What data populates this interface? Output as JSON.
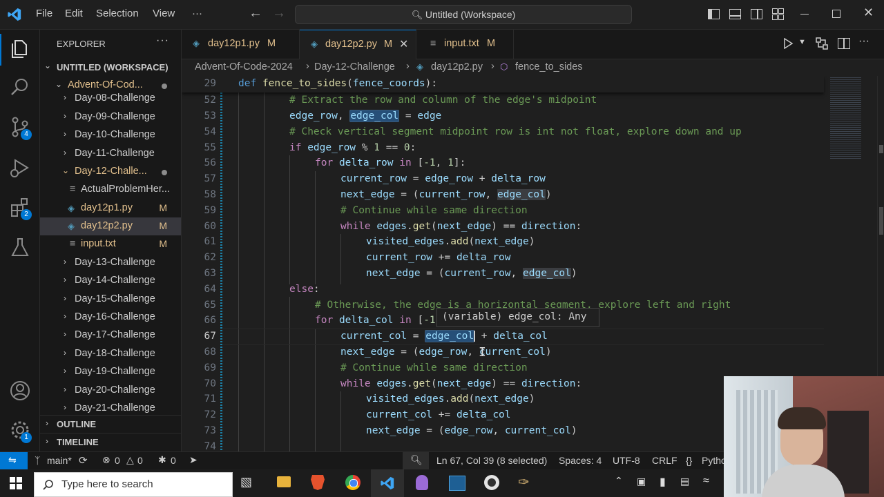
{
  "titlebar": {
    "menu": [
      "File",
      "Edit",
      "Selection",
      "View",
      "···"
    ],
    "search_text": "Untitled (Workspace)"
  },
  "activity": {
    "source_control_badge": "4",
    "extensions_badge": "2",
    "manage_badge": "1"
  },
  "sidebar": {
    "title": "EXPLORER",
    "workspace": "UNTITLED (WORKSPACE)",
    "root": "Advent-Of-Cod...",
    "items": [
      {
        "label": "Day-08-Challenge",
        "type": "folder"
      },
      {
        "label": "Day-09-Challenge",
        "type": "folder"
      },
      {
        "label": "Day-10-Challenge",
        "type": "folder"
      },
      {
        "label": "Day-11-Challenge",
        "type": "folder"
      },
      {
        "label": "Day-12-Challe...",
        "type": "folder-open"
      },
      {
        "label": "ActualProblemHer...",
        "type": "file"
      },
      {
        "label": "day12p1.py",
        "type": "py",
        "status": "M"
      },
      {
        "label": "day12p2.py",
        "type": "py",
        "status": "M"
      },
      {
        "label": "input.txt",
        "type": "txt",
        "status": "M"
      },
      {
        "label": "Day-13-Challenge",
        "type": "folder"
      },
      {
        "label": "Day-14-Challenge",
        "type": "folder"
      },
      {
        "label": "Day-15-Challenge",
        "type": "folder"
      },
      {
        "label": "Day-16-Challenge",
        "type": "folder"
      },
      {
        "label": "Day-17-Challenge",
        "type": "folder"
      },
      {
        "label": "Day-18-Challenge",
        "type": "folder"
      },
      {
        "label": "Day-19-Challenge",
        "type": "folder"
      },
      {
        "label": "Day-20-Challenge",
        "type": "folder"
      },
      {
        "label": "Day-21-Challenge",
        "type": "folder"
      }
    ],
    "outline": "OUTLINE",
    "timeline": "TIMELINE"
  },
  "tabs": [
    {
      "label": "day12p1.py",
      "status": "M"
    },
    {
      "label": "day12p2.py",
      "status": "M"
    },
    {
      "label": "input.txt",
      "status": "M"
    }
  ],
  "breadcrumb": [
    "Advent-Of-Code-2024",
    "Day-12-Challenge",
    "day12p2.py",
    "fence_to_sides"
  ],
  "editor": {
    "sticky_line": "29",
    "line_numbers": [
      "52",
      "53",
      "54",
      "55",
      "56",
      "57",
      "58",
      "59",
      "60",
      "61",
      "62",
      "63",
      "64",
      "65",
      "66",
      "67",
      "68",
      "69",
      "70",
      "71",
      "72",
      "73",
      "74"
    ],
    "hover_text": "(variable) edge_col: Any"
  },
  "statusbar": {
    "branch": "main*",
    "errors": "0",
    "warnings": "0",
    "ports": "0",
    "position": "Ln 67, Col 39 (8 selected)",
    "spaces": "Spaces: 4",
    "encoding": "UTF-8",
    "eol": "CRLF",
    "language": "Pytho"
  },
  "taskbar": {
    "search_placeholder": "Type here to search"
  },
  "colors": {
    "accent": "#0078d4",
    "modified": "#e2c08d"
  }
}
